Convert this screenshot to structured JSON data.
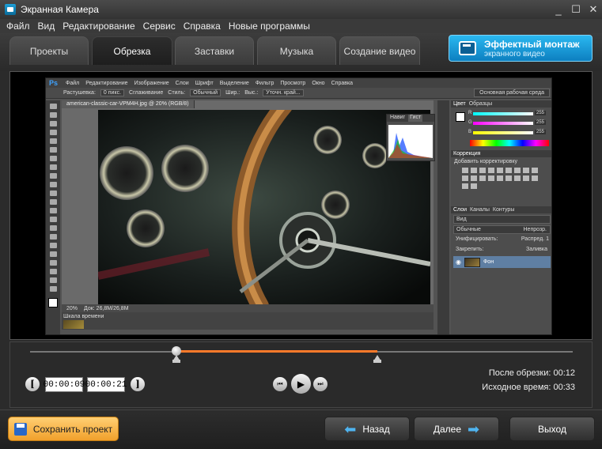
{
  "window": {
    "title": "Экранная Камера",
    "controls": [
      "_",
      "☐",
      "✕"
    ]
  },
  "menu": [
    "Файл",
    "Вид",
    "Редактирование",
    "Сервис",
    "Справка",
    "Новые программы"
  ],
  "tabs": [
    {
      "label": "Проекты"
    },
    {
      "label": "Обрезка"
    },
    {
      "label": "Заставки"
    },
    {
      "label": "Музыка"
    },
    {
      "label": "Создание видео"
    }
  ],
  "promo": {
    "title": "Эффектный монтаж",
    "subtitle": "экранного видео"
  },
  "photoshop": {
    "logo": "Ps",
    "menu": [
      "Файл",
      "Редактирование",
      "Изображение",
      "Слои",
      "Шрифт",
      "Выделение",
      "Фильтр",
      "Просмотр",
      "Окно",
      "Справка"
    ],
    "options": {
      "feather_label": "Растушевка:",
      "feather_value": "0 пикс.",
      "smooth_label": "Сглаживание",
      "style_label": "Стиль:",
      "style_value": "Обычный",
      "width_label": "Шир.:",
      "height_label": "Выс.:",
      "refine_label": "Уточн. край...",
      "workspace": "Основная рабочая среда"
    },
    "doc_tab": "american-classic-car-VPM4H.jpg @ 20% (RGB/8)",
    "status": {
      "zoom": "20%",
      "doc": "Док: 26,8M/26,8M"
    },
    "timeline_label": "Шкала времени",
    "nav_tabs": [
      "Навиг",
      "Гист"
    ],
    "color_tabs": [
      "Цвет",
      "Образцы"
    ],
    "rgb": {
      "r_label": "R",
      "g_label": "G",
      "b_label": "B",
      "r": "255",
      "g": "255",
      "b": "255"
    },
    "corrections": {
      "tab": "Коррекция",
      "title": "Добавить корректировку"
    },
    "layers": {
      "tabs": [
        "Слои",
        "Каналы",
        "Контуры"
      ],
      "kind": "Вид",
      "blend": "Обычные",
      "opacity_label": "Непрозр.",
      "unify_label": "Унифицировать:",
      "spread_label": "Распред. 1",
      "lock_label": "Закрепить:",
      "fill_label": "Заливка",
      "layer_name": "Фон"
    }
  },
  "trim": {
    "start_time": "00:00:09",
    "end_time": "00:00:21",
    "start_bracket": "[",
    "end_bracket": "]",
    "after_label": "После обрезки:",
    "after_value": "00:12",
    "original_label": "Исходное время:",
    "original_value": "00:33",
    "selection_start_fraction": 0.27,
    "selection_end_fraction": 0.64
  },
  "player": {
    "prev": "⏮",
    "play": "▶",
    "next": "⏭"
  },
  "footer": {
    "save_label": "Сохранить проект",
    "back_label": "Назад",
    "next_label": "Далее",
    "exit_label": "Выход"
  },
  "colors": {
    "accent": "#1ea0e0",
    "selection": "#ff7a2a",
    "save": "#f6b246"
  }
}
